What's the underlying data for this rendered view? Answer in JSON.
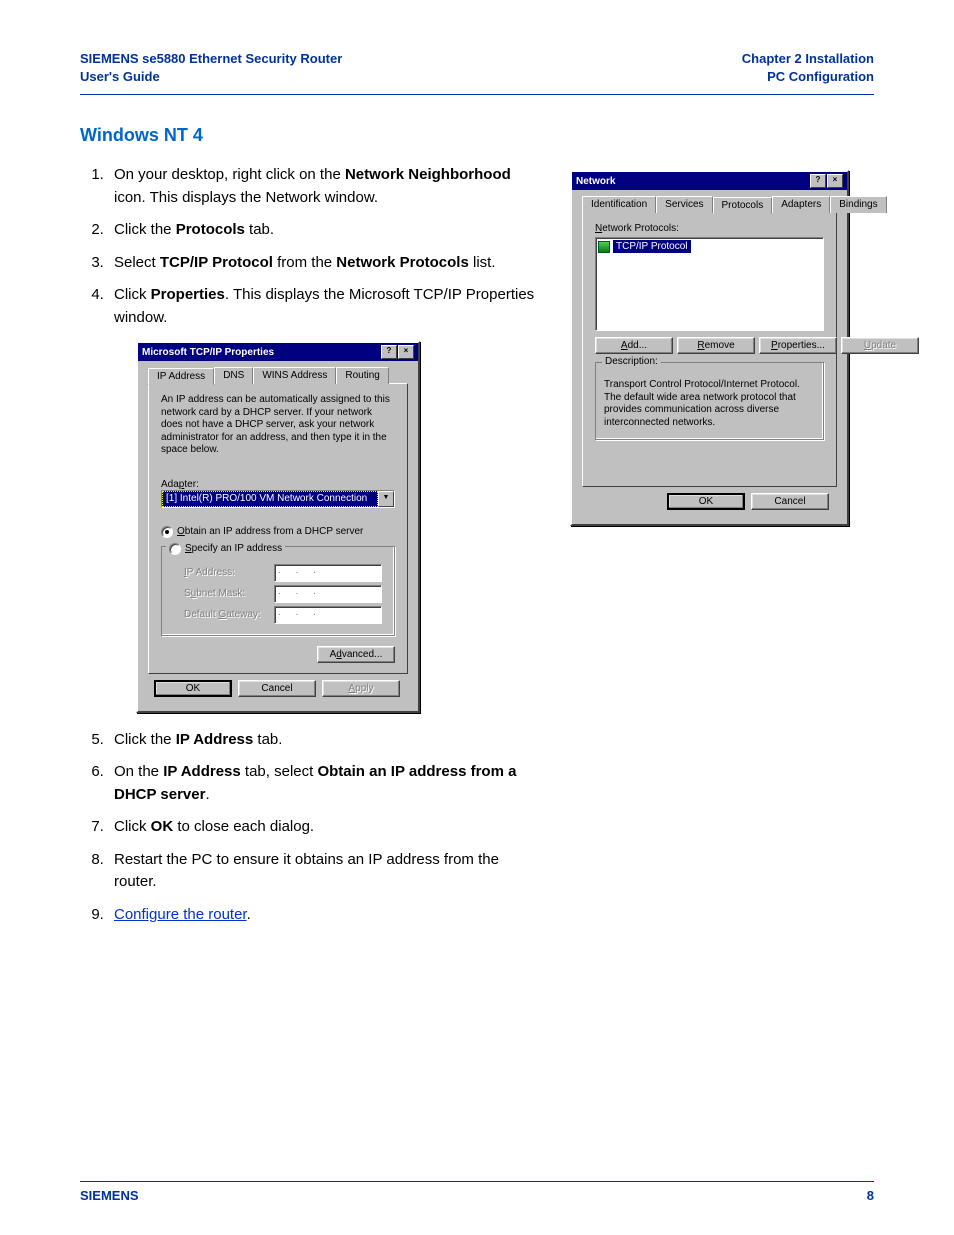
{
  "header": {
    "left_line1": "SIEMENS se5880 Ethernet Security Router",
    "left_line2": "User's Guide",
    "right_line1": "Chapter 2  Installation",
    "right_line2": "PC Configuration"
  },
  "section_title": "Windows NT 4",
  "steps": {
    "s1a": "On your desktop, right click on the ",
    "s1b": "Network Neighborhood",
    "s1c": " icon. This displays the Network window.",
    "s2a": "Click the ",
    "s2b": "Protocols",
    "s2c": " tab.",
    "s3a": "Select ",
    "s3b": "TCP/IP Protocol",
    "s3c": " from the ",
    "s3d": "Network Protocols",
    "s3e": " list.",
    "s4a": "Click ",
    "s4b": "Properties",
    "s4c": ". This displays the Microsoft TCP/IP Properties window.",
    "s5a": "Click the ",
    "s5b": "IP Address",
    "s5c": " tab.",
    "s6a": "On the ",
    "s6b": "IP Address",
    "s6c": " tab, select ",
    "s6d": "Obtain an IP address from a DHCP server",
    "s6e": ".",
    "s7a": "Click ",
    "s7b": "OK",
    "s7c": " to close each dialog.",
    "s8": "Restart the PC to ensure it obtains an IP address from the router.",
    "s9": "Configure the router",
    "s9dot": "."
  },
  "network_dialog": {
    "title": "Network",
    "tabs": {
      "identification": "Identification",
      "services": "Services",
      "protocols": "Protocols",
      "adapters": "Adapters",
      "bindings": "Bindings"
    },
    "list_label_pre": "N",
    "list_label": "etwork Protocols:",
    "item": "TCP/IP Protocol",
    "buttons": {
      "add": "Add...",
      "add_u": "A",
      "remove": "Remove",
      "remove_u": "R",
      "properties": "Properties...",
      "properties_u": "P",
      "update": "Update",
      "update_u": "U"
    },
    "desc_legend": "Description:",
    "desc_text": "Transport Control Protocol/Internet Protocol. The default wide area network protocol that provides communication across diverse interconnected networks.",
    "ok": "OK",
    "cancel": "Cancel"
  },
  "tcpip_dialog": {
    "title": "Microsoft TCP/IP Properties",
    "tabs": {
      "ip": "IP Address",
      "dns": "DNS",
      "wins": "WINS Address",
      "routing": "Routing"
    },
    "blurb": "An IP address can be automatically assigned to this network card by a DHCP server. If your network does not have a DHCP server, ask your network administrator for an address, and then type it in the space below.",
    "adapter_label": "Adapter:",
    "adapter_value": "[1] Intel(R) PRO/100 VM Network Connection",
    "radio_obtain_u": "O",
    "radio_obtain": "btain an IP address from a DHCP server",
    "radio_specify_u": "S",
    "radio_specify": "pecify an IP address",
    "ip_label": "IP Address:",
    "mask_label": "Subnet Mask:",
    "gw_label": "Default Gateway:",
    "dots": ".   .   .",
    "advanced": "Advanced...",
    "advanced_u": "d",
    "ok": "OK",
    "cancel": "Cancel",
    "apply": "Apply",
    "apply_u": "A"
  },
  "footer": {
    "left": "SIEMENS",
    "right": "8"
  }
}
